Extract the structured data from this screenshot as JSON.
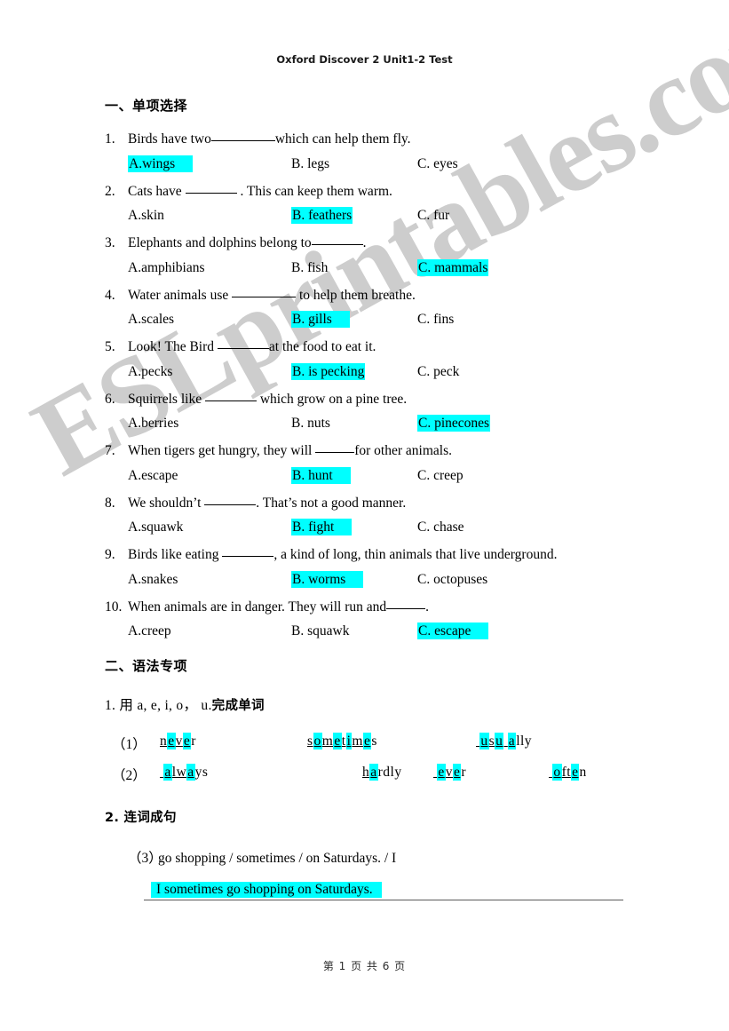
{
  "header": {
    "title": "Oxford Discover 2 Unit1-2 Test"
  },
  "watermark": {
    "text": "ESLprintables.com",
    "color": "#cdcdcd"
  },
  "highlight_color": "#00ffff",
  "section1": {
    "heading": "一、单项选择",
    "questions": [
      {
        "num": "1.",
        "pre": "Birds have two",
        "post": "which can help them fly.",
        "options": [
          {
            "label": "A.wings",
            "highlighted": true
          },
          {
            "label": "B. legs",
            "highlighted": false
          },
          {
            "label": "C. eyes",
            "highlighted": false
          }
        ]
      },
      {
        "num": "2.",
        "pre": "Cats have ",
        "post": " . This can keep them warm.",
        "options": [
          {
            "label": "A.skin",
            "highlighted": false
          },
          {
            "label": "B. feathers",
            "highlighted": true
          },
          {
            "label": "C. fur",
            "highlighted": false
          }
        ]
      },
      {
        "num": "3.",
        "pre": "Elephants and dolphins belong to",
        "post": ".",
        "options": [
          {
            "label": "A.amphibians",
            "highlighted": false
          },
          {
            "label": "B. fish",
            "highlighted": false
          },
          {
            "label": "C. mammals",
            "highlighted": true
          }
        ]
      },
      {
        "num": "4.",
        "pre": "Water animals use ",
        "post": " to help them breathe.",
        "options": [
          {
            "label": "A.scales",
            "highlighted": false
          },
          {
            "label": "B. gills",
            "highlighted": true
          },
          {
            "label": "C. fins",
            "highlighted": false
          }
        ]
      },
      {
        "num": "5.",
        "pre": "Look! The Bird ",
        "post": "at the food to eat it.",
        "options": [
          {
            "label": "A.pecks",
            "highlighted": false
          },
          {
            "label": "B. is pecking",
            "highlighted": true
          },
          {
            "label": "C. peck",
            "highlighted": false
          }
        ]
      },
      {
        "num": "6.",
        "pre": "Squirrels like ",
        "post": " which grow on a pine tree.",
        "options": [
          {
            "label": "A.berries",
            "highlighted": false
          },
          {
            "label": "B. nuts",
            "highlighted": false
          },
          {
            "label": "C. pinecones",
            "highlighted": true
          }
        ]
      },
      {
        "num": "7.",
        "pre": "When tigers get hungry, they will ",
        "post": "for other animals.",
        "options": [
          {
            "label": "A.escape",
            "highlighted": false
          },
          {
            "label": "B. hunt",
            "highlighted": true
          },
          {
            "label": "C. creep",
            "highlighted": false
          }
        ]
      },
      {
        "num": "8.",
        "pre": "We shouldn’t ",
        "post": ". That’s not a good manner.",
        "options": [
          {
            "label": "A.squawk",
            "highlighted": false
          },
          {
            "label": "B. fight",
            "highlighted": true
          },
          {
            "label": "C. chase",
            "highlighted": false
          }
        ]
      },
      {
        "num": "9.",
        "pre": "Birds like eating ",
        "post": ", a kind of long, thin animals that live underground.",
        "options": [
          {
            "label": "A.snakes",
            "highlighted": false
          },
          {
            "label": "B. worms",
            "highlighted": true
          },
          {
            "label": "C. octopuses",
            "highlighted": false
          }
        ]
      },
      {
        "num": "10.",
        "pre": "When animals are in danger. They will run and",
        "post": ".",
        "options": [
          {
            "label": "A.creep",
            "highlighted": false
          },
          {
            "label": "B. squawk",
            "highlighted": false
          },
          {
            "label": "C. escape",
            "highlighted": true
          }
        ]
      }
    ]
  },
  "section2": {
    "heading": "二、语法专项",
    "task1": {
      "heading_num": "1. ",
      "heading_latin": "用 a, e, i, o， u.",
      "heading_cjk": "完成单词",
      "rows": [
        {
          "label": "（1）",
          "words": [
            {
              "parts": [
                {
                  "t": "n",
                  "hl": false,
                  "u": true
                },
                {
                  "t": "e",
                  "hl": true,
                  "u": true
                },
                {
                  "t": "v",
                  "hl": false,
                  "u": true
                },
                {
                  "t": "e",
                  "hl": true,
                  "u": true
                },
                {
                  "t": "r",
                  "hl": false,
                  "u": false
                }
              ]
            },
            {
              "parts": [
                {
                  "t": "s",
                  "hl": false,
                  "u": true
                },
                {
                  "t": "o",
                  "hl": true,
                  "u": true
                },
                {
                  "t": "m",
                  "hl": false,
                  "u": true
                },
                {
                  "t": "e",
                  "hl": true,
                  "u": true
                },
                {
                  "t": "t",
                  "hl": false,
                  "u": true
                },
                {
                  "t": "i",
                  "hl": true,
                  "u": true
                },
                {
                  "t": "m",
                  "hl": false,
                  "u": true
                },
                {
                  "t": "e",
                  "hl": true,
                  "u": true
                },
                {
                  "t": "s",
                  "hl": false,
                  "u": false
                }
              ]
            },
            {
              "parts": [
                {
                  "t": "",
                  "hl": false,
                  "u": true
                },
                {
                  "t": "u",
                  "hl": true,
                  "u": true
                },
                {
                  "t": "s",
                  "hl": false,
                  "u": true
                },
                {
                  "t": "u",
                  "hl": true,
                  "u": true
                },
                {
                  "t": "",
                  "hl": false,
                  "u": true
                },
                {
                  "t": "a",
                  "hl": true,
                  "u": true
                },
                {
                  "t": "lly",
                  "hl": false,
                  "u": false
                }
              ]
            }
          ]
        },
        {
          "label": "（2）",
          "words": [
            {
              "parts": [
                {
                  "t": "",
                  "hl": false,
                  "u": true
                },
                {
                  "t": "a",
                  "hl": true,
                  "u": true
                },
                {
                  "t": "lw",
                  "hl": false,
                  "u": true
                },
                {
                  "t": "a",
                  "hl": true,
                  "u": true
                },
                {
                  "t": "ys",
                  "hl": false,
                  "u": false
                }
              ]
            },
            {
              "parts": [
                {
                  "t": "h",
                  "hl": false,
                  "u": true
                },
                {
                  "t": "a",
                  "hl": true,
                  "u": true
                },
                {
                  "t": "rdly",
                  "hl": false,
                  "u": false
                }
              ]
            },
            {
              "parts": [
                {
                  "t": "",
                  "hl": false,
                  "u": true
                },
                {
                  "t": "e",
                  "hl": true,
                  "u": true
                },
                {
                  "t": "v",
                  "hl": false,
                  "u": true
                },
                {
                  "t": "e",
                  "hl": true,
                  "u": true
                },
                {
                  "t": "r",
                  "hl": false,
                  "u": false
                }
              ]
            },
            {
              "parts": [
                {
                  "t": "",
                  "hl": false,
                  "u": true
                },
                {
                  "t": "o",
                  "hl": true,
                  "u": true
                },
                {
                  "t": "ft",
                  "hl": false,
                  "u": true
                },
                {
                  "t": "e",
                  "hl": true,
                  "u": true
                },
                {
                  "t": "n",
                  "hl": false,
                  "u": false
                }
              ]
            }
          ]
        }
      ]
    },
    "task2": {
      "heading": "2. 连词成句",
      "question_num": "（3）",
      "question_text": "go shopping / sometimes / on Saturdays. / I",
      "answer": "I sometimes go shopping on Saturdays."
    }
  },
  "footer": {
    "text": "第 1 页 共 6 页"
  }
}
